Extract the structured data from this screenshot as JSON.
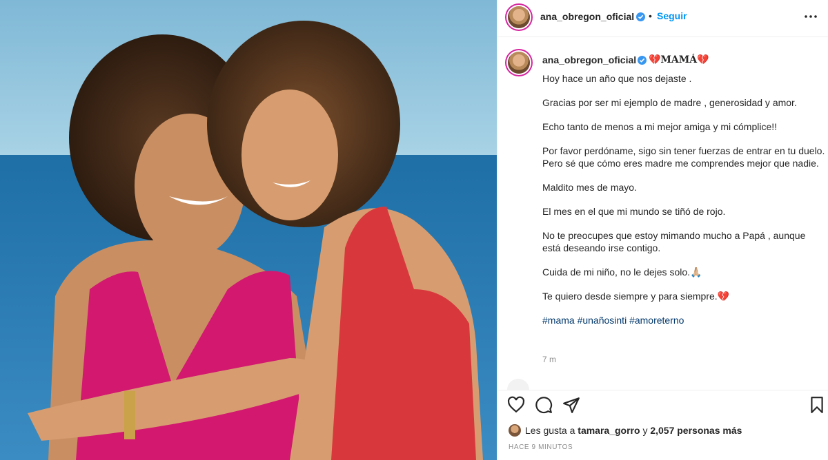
{
  "post": {
    "username": "ana_obregon_oficial",
    "follow_label": "Seguir",
    "separator": "•",
    "caption_title": "💔MAMÁ💔",
    "caption_lines": [
      "Hoy hace un año que nos dejaste .",
      "Gracias por ser mi ejemplo de madre , generosidad y amor.",
      "Echo tanto de menos a mi mejor amiga y mi cómplice!!",
      "Por favor perdóname, sigo sin tener fuerzas de entrar en tu duelo.",
      "Pero sé que cómo eres madre me comprendes mejor que nadie.",
      "Maldito mes de mayo.",
      "El mes en el que mi mundo se tiñó de rojo.",
      "No te preocupes que estoy mimando mucho a Papá , aunque está deseando irse contigo.",
      "Cuida de mi niño, no le dejes solo.🙏🏼",
      "Te quiero desde siempre y para siempre.💔"
    ],
    "hashtags": "#mama #unañosinti #amoreterno",
    "caption_time": "7 m",
    "likes": {
      "prefix": "Les gusta a",
      "user": "tamara_gorro",
      "joiner": "y",
      "count_text": "2,057 personas más"
    },
    "posted_ago": "HACE 9 MINUTOS",
    "icons": [
      "verified-badge-icon",
      "more-options-icon",
      "heart-icon",
      "comment-icon",
      "share-icon",
      "bookmark-icon"
    ],
    "colors": {
      "follow": "#0095f6",
      "hashtag": "#00376b",
      "verified": "#3897f0",
      "muted": "#8e8e8e"
    }
  }
}
